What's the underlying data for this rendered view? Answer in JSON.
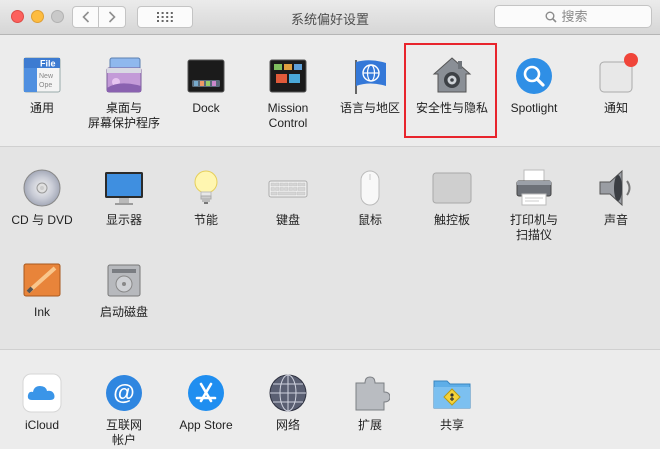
{
  "window": {
    "title": "系统偏好设置",
    "search_placeholder": "搜索"
  },
  "colors": {
    "highlight_box": "#e8242c",
    "close": "#fc615d",
    "minimize": "#fdbc40"
  },
  "sections": [
    {
      "items": [
        {
          "label": "通用",
          "icon": "general-icon"
        },
        {
          "label": "桌面与\n屏幕保护程序",
          "icon": "desktop-screensaver-icon"
        },
        {
          "label": "Dock",
          "icon": "dock-icon"
        },
        {
          "label": "Mission\nControl",
          "icon": "mission-control-icon"
        },
        {
          "label": "语言与地区",
          "icon": "language-region-icon"
        },
        {
          "label": "安全性与隐私",
          "icon": "security-privacy-icon"
        },
        {
          "label": "Spotlight",
          "icon": "spotlight-icon"
        },
        {
          "label": "通知",
          "icon": "notifications-icon"
        }
      ]
    },
    {
      "items": [
        {
          "label": "CD 与 DVD",
          "icon": "cd-dvd-icon"
        },
        {
          "label": "显示器",
          "icon": "displays-icon"
        },
        {
          "label": "节能",
          "icon": "energy-saver-icon"
        },
        {
          "label": "键盘",
          "icon": "keyboard-icon"
        },
        {
          "label": "鼠标",
          "icon": "mouse-icon"
        },
        {
          "label": "触控板",
          "icon": "trackpad-icon"
        },
        {
          "label": "打印机与\n扫描仪",
          "icon": "printers-scanners-icon"
        },
        {
          "label": "声音",
          "icon": "sound-icon"
        },
        {
          "label": "Ink",
          "icon": "ink-icon"
        },
        {
          "label": "启动磁盘",
          "icon": "startup-disk-icon"
        }
      ]
    },
    {
      "items": [
        {
          "label": "iCloud",
          "icon": "icloud-icon"
        },
        {
          "label": "互联网\n帐户",
          "icon": "internet-accounts-icon"
        },
        {
          "label": "App Store",
          "icon": "app-store-icon"
        },
        {
          "label": "网络",
          "icon": "network-icon"
        },
        {
          "label": "扩展",
          "icon": "extensions-icon"
        },
        {
          "label": "共享",
          "icon": "sharing-icon"
        }
      ]
    }
  ]
}
